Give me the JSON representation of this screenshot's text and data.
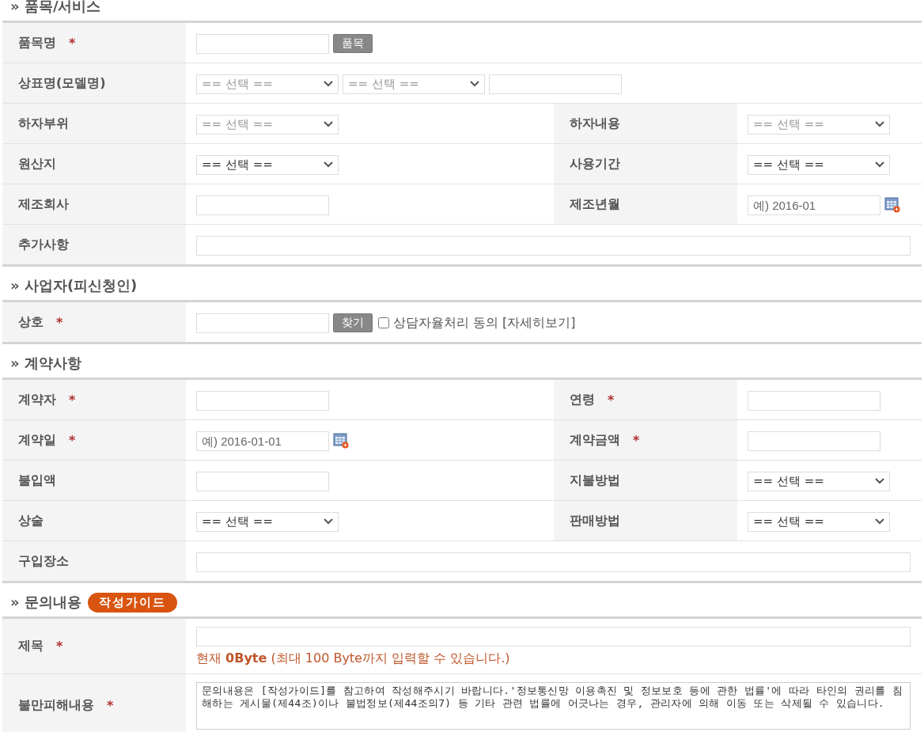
{
  "sections": [
    {
      "title": "» 품목/서비스",
      "rows": [
        {
          "fields": [
            {
              "label": "품목명",
              "mark": "*",
              "full": true,
              "controls": [
                {
                  "kind": "input"
                },
                {
                  "kind": "button",
                  "label": "품목"
                }
              ]
            }
          ]
        },
        {
          "fields": [
            {
              "label": "상표명(모델명)",
              "full": true,
              "controls": [
                {
                  "kind": "select",
                  "text": "== 선택 ==",
                  "disabled": true
                },
                {
                  "kind": "select",
                  "text": "== 선택 ==",
                  "disabled": true
                },
                {
                  "kind": "input"
                }
              ]
            }
          ]
        },
        {
          "fields": [
            {
              "label": "하자부위",
              "full": false,
              "controls": [
                {
                  "kind": "select",
                  "text": "== 선택 ==",
                  "disabled": true
                }
              ]
            },
            {
              "label": "하자내용",
              "full": false,
              "controls": [
                {
                  "kind": "select",
                  "text": "== 선택 ==",
                  "disabled": true
                }
              ]
            }
          ]
        },
        {
          "fields": [
            {
              "label": "원산지",
              "full": false,
              "controls": [
                {
                  "kind": "select",
                  "text": "== 선택 ==",
                  "disabled": false
                }
              ]
            },
            {
              "label": "사용기간",
              "full": false,
              "controls": [
                {
                  "kind": "select",
                  "text": "== 선택 ==",
                  "disabled": false
                }
              ]
            }
          ]
        },
        {
          "fields": [
            {
              "label": "제조회사",
              "full": false,
              "controls": [
                {
                  "kind": "input"
                }
              ]
            },
            {
              "label": "제조년월",
              "full": false,
              "controls": [
                {
                  "kind": "date",
                  "placeholder": "예) 2016-01"
                }
              ]
            }
          ]
        },
        {
          "fields": [
            {
              "label": "추가사항",
              "full": true,
              "controls": [
                {
                  "kind": "longinput"
                }
              ]
            }
          ]
        }
      ]
    },
    {
      "title": "» 사업자(피신청인)",
      "rows": [
        {
          "fields": [
            {
              "label": "상호",
              "mark": "*",
              "full": true,
              "controls": [
                {
                  "kind": "input"
                },
                {
                  "kind": "button",
                  "label": "찾기"
                },
                {
                  "kind": "checkbox",
                  "label": "상담자율처리 동의",
                  "checked": false
                },
                {
                  "kind": "link",
                  "label": "[자세히보기]"
                }
              ]
            }
          ]
        }
      ]
    },
    {
      "title": "» 계약사항",
      "rows": [
        {
          "fields": [
            {
              "label": "계약자",
              "mark": "*",
              "full": false,
              "controls": [
                {
                  "kind": "input"
                }
              ]
            },
            {
              "label": "연령",
              "mark": "*",
              "full": false,
              "controls": [
                {
                  "kind": "input"
                }
              ]
            }
          ]
        },
        {
          "fields": [
            {
              "label": "계약일",
              "mark": "*",
              "full": false,
              "controls": [
                {
                  "kind": "date",
                  "placeholder": "예) 2016-01-01"
                }
              ]
            },
            {
              "label": "계약금액",
              "mark": "*",
              "full": false,
              "controls": [
                {
                  "kind": "input"
                }
              ]
            }
          ]
        },
        {
          "fields": [
            {
              "label": "불입액",
              "full": false,
              "controls": [
                {
                  "kind": "input"
                }
              ]
            },
            {
              "label": "지불방법",
              "full": false,
              "controls": [
                {
                  "kind": "select",
                  "text": "== 선택 ==",
                  "disabled": false
                }
              ]
            }
          ]
        },
        {
          "fields": [
            {
              "label": "상술",
              "full": false,
              "controls": [
                {
                  "kind": "select",
                  "text": "== 선택 ==",
                  "disabled": false
                }
              ]
            },
            {
              "label": "판매방법",
              "full": false,
              "controls": [
                {
                  "kind": "select",
                  "text": "== 선택 ==",
                  "disabled": false
                }
              ]
            }
          ]
        },
        {
          "fields": [
            {
              "label": "구입장소",
              "full": true,
              "controls": [
                {
                  "kind": "longinput"
                }
              ]
            }
          ]
        }
      ]
    },
    {
      "title": "» 문의내용",
      "badge": "작성가이드",
      "rows": [
        {
          "fields": [
            {
              "label": "제목",
              "mark": "*",
              "full": true,
              "controls": [
                {
                  "kind": "longinput"
                },
                {
                  "kind": "hint",
                  "text": "현재 **0Byte** (최대 100 Byte까지 입력할 수 있습니다.)"
                }
              ]
            }
          ]
        },
        {
          "fields": [
            {
              "label": "불만피해내용",
              "mark": "*",
              "full": true,
              "controls": [
                {
                  "kind": "textarea",
                  "value": "문의내용은 [작성가이드]를 참고하여 작성해주시기 바랍니다.'정보통신망 이용촉진 및 정보보호 등에 관한 법률'에 따라 타인의 권리를 침해하는 게시물(제44조)이나 불법정보(제44조의7) 등 기타 관련 법률에 어긋나는 경우, 관리자에 의해 이동 또는 삭제될 수 있습니다."
                }
              ]
            }
          ]
        }
      ]
    }
  ]
}
